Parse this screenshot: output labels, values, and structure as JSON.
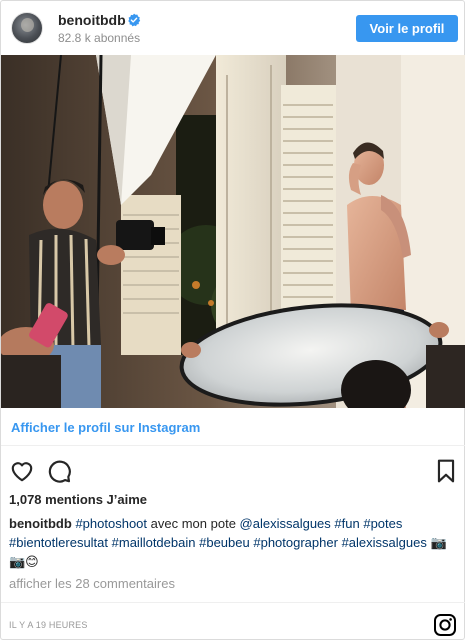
{
  "post": {
    "username": "benoitbdb",
    "followers": "82.8 k abonnés",
    "view_profile_label": "Voir le profil",
    "instagram_link": "Afficher le profil sur Instagram",
    "likes": "1,078 mentions J’aime",
    "caption": {
      "user": "benoitbdb",
      "segments": [
        {
          "text": " ",
          "tag": false
        },
        {
          "text": "#photoshoot",
          "tag": true
        },
        {
          "text": " avec mon pote ",
          "tag": false
        },
        {
          "text": "@alexissalgues",
          "tag": true
        },
        {
          "text": " ",
          "tag": false
        },
        {
          "text": "#fun",
          "tag": true
        },
        {
          "text": " ",
          "tag": false
        },
        {
          "text": "#potes",
          "tag": true
        },
        {
          "text": " ",
          "tag": false
        },
        {
          "text": "#bientotleresultat",
          "tag": true
        },
        {
          "text": " ",
          "tag": false
        },
        {
          "text": "#maillotdebain",
          "tag": true
        },
        {
          "text": " ",
          "tag": false
        },
        {
          "text": "#beubeu",
          "tag": true
        },
        {
          "text": " ",
          "tag": false
        },
        {
          "text": "#photographer",
          "tag": true
        },
        {
          "text": " ",
          "tag": false
        },
        {
          "text": "#alexissalgues",
          "tag": true
        },
        {
          "text": " 📷📷😊",
          "tag": false
        }
      ]
    },
    "comments_link": "afficher les 28 commentaires",
    "timestamp": "IL Y A 19 HEURES"
  },
  "icons": {
    "verified": "verified-badge-icon",
    "like": "heart-icon",
    "comment": "comment-icon",
    "save": "bookmark-icon",
    "brand": "instagram-logo-icon"
  },
  "colors": {
    "accent": "#3897f0",
    "hashtag": "#003569",
    "muted": "#8e8e8e",
    "text": "#262626"
  }
}
